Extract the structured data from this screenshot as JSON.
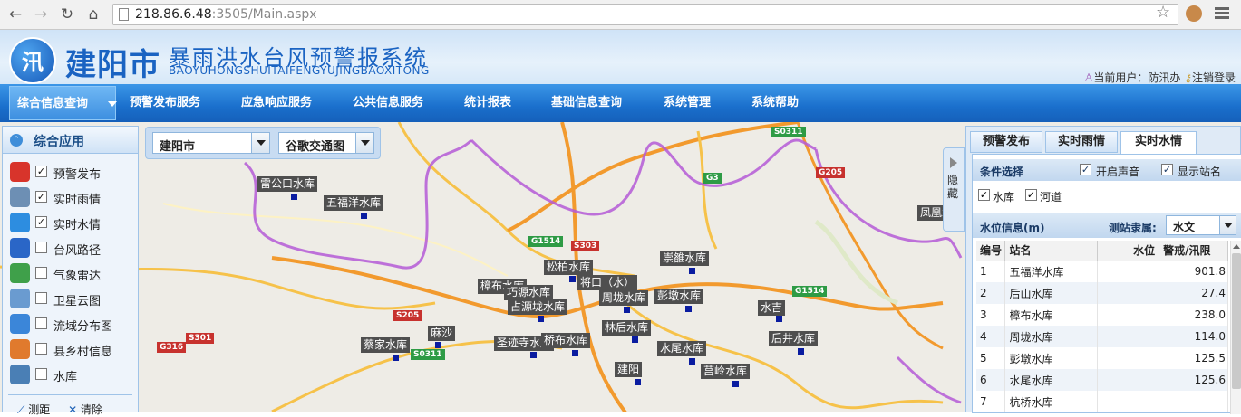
{
  "browser": {
    "url_host": "218.86.6.48",
    "url_path": ":3505/Main.aspx"
  },
  "header": {
    "logo_char": "汛",
    "city": "建阳市",
    "system_name": "暴雨洪水台风预警报系统",
    "pinyin": "BAOYUHONGSHUITAIFENGYUJINGBAOXITONG",
    "current_user_label": "当前用户：",
    "current_user": "防汛办",
    "logout": "注销登录"
  },
  "nav": {
    "items": [
      "综合信息查询",
      "预警发布服务",
      "应急响应服务",
      "公共信息服务",
      "统计报表",
      "基础信息查询",
      "系统管理",
      "系统帮助"
    ]
  },
  "left_panel": {
    "title": "综合应用",
    "layers": [
      {
        "label": "预警发布",
        "checked": true,
        "icon": "warning-light-icon",
        "color": "#d8342b"
      },
      {
        "label": "实时雨情",
        "checked": true,
        "icon": "rain-cloud-icon",
        "color": "#6d8fb4"
      },
      {
        "label": "实时水情",
        "checked": true,
        "icon": "water-drop-icon",
        "color": "#2d8de0"
      },
      {
        "label": "台风路径",
        "checked": false,
        "icon": "typhoon-icon",
        "color": "#2a66c7"
      },
      {
        "label": "气象雷达",
        "checked": false,
        "icon": "radar-icon",
        "color": "#3fa04a"
      },
      {
        "label": "卫星云图",
        "checked": false,
        "icon": "satellite-icon",
        "color": "#6a9bd0"
      },
      {
        "label": "流域分布图",
        "checked": false,
        "icon": "globe-icon",
        "color": "#3b86d9"
      },
      {
        "label": "县乡村信息",
        "checked": false,
        "icon": "house-icon",
        "color": "#e07a2d"
      },
      {
        "label": "水库",
        "checked": false,
        "icon": "reservoir-icon",
        "color": "#4a7fb5"
      }
    ],
    "tools": {
      "measure": "测距",
      "clear": "清除"
    }
  },
  "map_controls": {
    "region": "建阳市",
    "basemap": "谷歌交通图"
  },
  "hide_tab": "隐藏",
  "map_labels": [
    "雷公口水库",
    "五福洋水库",
    "松柏水库",
    "将口（水）",
    "樟布水库",
    "巧源水库",
    "占源垅水库",
    "周垅水库",
    "崇雒水库",
    "彭墩水库",
    "水吉",
    "林后水库",
    "麻沙",
    "蔡家水库",
    "圣迹寺水库",
    "桥布水库",
    "水尾水库",
    "后井水库",
    "莒岭水库",
    "建阳",
    "凤凰水库"
  ],
  "road_shields": [
    "S0311",
    "G205",
    "G3",
    "G1514",
    "S303",
    "G1514",
    "S205",
    "S301",
    "G316",
    "S0311",
    "S303"
  ],
  "right_panel": {
    "tabs": [
      "预警发布",
      "实时雨情",
      "实时水情"
    ],
    "active_tab": "实时水情",
    "condition_title": "条件选择",
    "sound_on": "开启声音",
    "show_station_name": "显示站名",
    "reservoir": "水库",
    "river": "河道",
    "water_info_title": "水位信息(m)",
    "station_belong": "测站隶属:",
    "station_belong_value": "水文",
    "columns": [
      "编号",
      "站名",
      "水位",
      "警戒/汛限"
    ],
    "rows": [
      {
        "no": "1",
        "name": "五福洋水库",
        "level": "",
        "warn": "901.8"
      },
      {
        "no": "2",
        "name": "后山水库",
        "level": "",
        "warn": "27.4"
      },
      {
        "no": "3",
        "name": "樟布水库",
        "level": "",
        "warn": "238.0"
      },
      {
        "no": "4",
        "name": "周垅水库",
        "level": "",
        "warn": "114.0"
      },
      {
        "no": "5",
        "name": "彭墩水库",
        "level": "",
        "warn": "125.5"
      },
      {
        "no": "6",
        "name": "水尾水库",
        "level": "",
        "warn": "125.6"
      },
      {
        "no": "7",
        "name": "杭桥水库",
        "level": "",
        "warn": ""
      }
    ]
  }
}
